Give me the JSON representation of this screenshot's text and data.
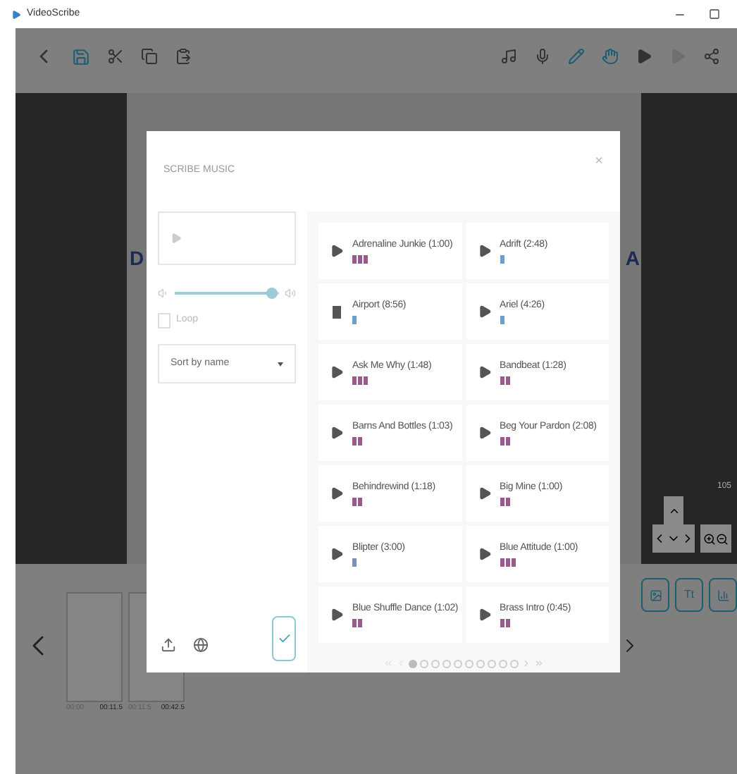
{
  "window": {
    "title": "VideoScribe"
  },
  "panel": {
    "text_button": "Tt"
  },
  "canvas": {
    "left_letter": "D",
    "right_letter": "A",
    "zoom_reading": "105"
  },
  "dialog": {
    "title": "SCRIBE MUSIC",
    "close": "×",
    "volume": {
      "level": 0.93
    },
    "loop": {
      "label": "Loop",
      "checked": false
    },
    "sort": {
      "value": "Sort by name"
    },
    "tracks": [
      {
        "title": "Adrenaline Junkie (1:00)",
        "playing": false,
        "kind": "fast",
        "color": "#9b5a8e"
      },
      {
        "title": "Adrift (2:48)",
        "playing": false,
        "kind": "slow",
        "color": "#6c9ecb"
      },
      {
        "title": "Airport (8:56)",
        "playing": true,
        "kind": "slow",
        "color": "#6c9ecb"
      },
      {
        "title": "Ariel (4:26)",
        "playing": false,
        "kind": "slow",
        "color": "#6c9ecb"
      },
      {
        "title": "Ask Me Why (1:48)",
        "playing": false,
        "kind": "fast",
        "color": "#9b5a8e"
      },
      {
        "title": "Bandbeat (1:28)",
        "playing": false,
        "kind": "medium",
        "color": "#9b5a8e"
      },
      {
        "title": "Barns And Bottles (1:03)",
        "playing": false,
        "kind": "medium",
        "color": "#9b5a8e"
      },
      {
        "title": "Beg Your Pardon (2:08)",
        "playing": false,
        "kind": "medium",
        "color": "#9b5a8e"
      },
      {
        "title": "Behindrewind (1:18)",
        "playing": false,
        "kind": "medium",
        "color": "#9b5a8e"
      },
      {
        "title": "Big Mine (1:00)",
        "playing": false,
        "kind": "medium",
        "color": "#9b5a8e"
      },
      {
        "title": "Blipter (3:00)",
        "playing": false,
        "kind": "slow",
        "color": "#7d8fb8"
      },
      {
        "title": "Blue Attitude (1:00)",
        "playing": false,
        "kind": "fast",
        "color": "#9b5a8e"
      },
      {
        "title": "Blue Shuffle Dance (1:02)",
        "playing": false,
        "kind": "medium",
        "color": "#9b5a8e"
      },
      {
        "title": "Brass Intro (0:45)",
        "playing": false,
        "kind": "medium",
        "color": "#9b5a8e"
      }
    ],
    "pages": [
      {
        "selected": true
      },
      {
        "selected": false
      },
      {
        "selected": false
      },
      {
        "selected": false
      },
      {
        "selected": false
      },
      {
        "selected": false
      },
      {
        "selected": false
      },
      {
        "selected": false
      },
      {
        "selected": false
      },
      {
        "selected": false
      }
    ]
  },
  "timeline": {
    "frames": [
      {
        "start": "00:00",
        "end": "00:11.5"
      },
      {
        "start": "00:11.5",
        "end": "00:42.5"
      }
    ]
  }
}
